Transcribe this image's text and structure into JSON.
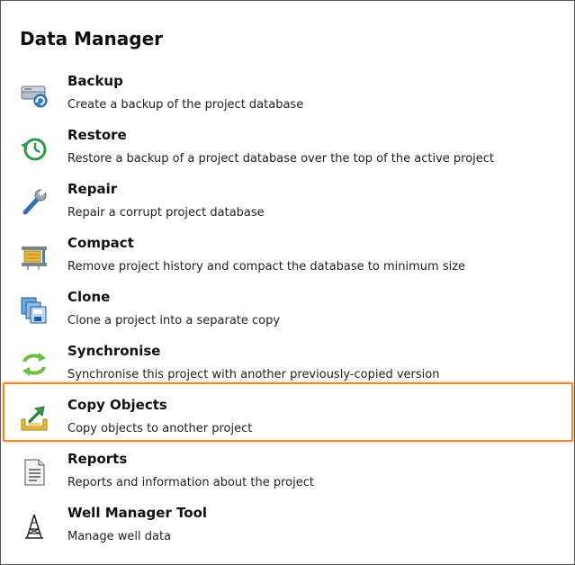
{
  "page_title": "Data Manager",
  "accent_color": "#e8892b",
  "items": [
    {
      "label": "Backup",
      "description": "Create a backup of the project database",
      "icon": "backup-icon"
    },
    {
      "label": "Restore",
      "description": "Restore a backup of a project database over the top of the active project",
      "icon": "restore-icon"
    },
    {
      "label": "Repair",
      "description": "Repair a corrupt project database",
      "icon": "wrench-icon"
    },
    {
      "label": "Compact",
      "description": "Remove project history and compact the database to minimum size",
      "icon": "compact-icon"
    },
    {
      "label": "Clone",
      "description": "Clone a project into a separate copy",
      "icon": "clone-icon"
    },
    {
      "label": "Synchronise",
      "description": "Synchronise this project with another previously-copied version",
      "icon": "sync-icon"
    },
    {
      "label": "Copy Objects",
      "description": "Copy objects to another project",
      "icon": "copy-objects-icon",
      "selected": true
    },
    {
      "label": "Reports",
      "description": "Reports and information about the project",
      "icon": "document-icon"
    },
    {
      "label": "Well Manager Tool",
      "description": "Manage well data",
      "icon": "well-tower-icon"
    }
  ]
}
